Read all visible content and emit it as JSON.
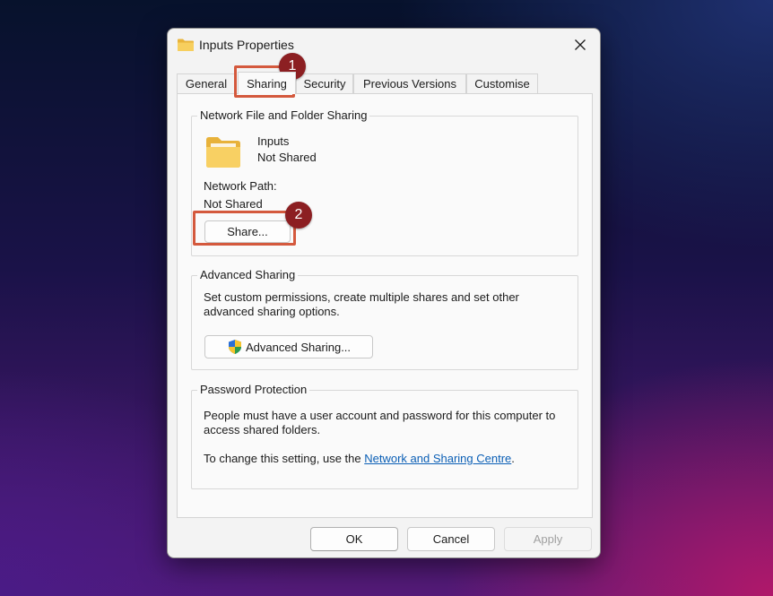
{
  "window": {
    "title": "Inputs Properties",
    "close_glyph": "✕"
  },
  "tabs": [
    {
      "label": "General"
    },
    {
      "label": "Sharing",
      "active": true
    },
    {
      "label": "Security"
    },
    {
      "label": "Previous Versions"
    },
    {
      "label": "Customise"
    }
  ],
  "network_sharing": {
    "group_title": "Network File and Folder Sharing",
    "folder_name": "Inputs",
    "folder_status": "Not Shared",
    "path_label": "Network Path:",
    "path_value": "Not Shared",
    "share_button": "Share..."
  },
  "advanced_sharing": {
    "group_title": "Advanced Sharing",
    "description_line1": "Set custom permissions, create multiple shares and set other",
    "description_line2": "advanced sharing options.",
    "button": "Advanced Sharing..."
  },
  "password_protection": {
    "group_title": "Password Protection",
    "description_line1": "People must have a user account and password for this computer to",
    "description_line2": "access shared folders.",
    "change_prefix": "To change this setting, use the ",
    "link_text": "Network and Sharing Centre",
    "change_suffix": "."
  },
  "footer": {
    "ok": "OK",
    "cancel": "Cancel",
    "apply": "Apply"
  },
  "annotations": {
    "step1": "1",
    "step2": "2",
    "highlight_color": "#d4593d",
    "badge_color": "#8c1f22"
  },
  "icons": {
    "title_icon": "folder-icon",
    "folder_large": "folder-icon",
    "advanced_button_icon": "uac-shield-icon"
  },
  "colors": {
    "link": "#0b5fb5",
    "folder": "#f7cf5e"
  }
}
